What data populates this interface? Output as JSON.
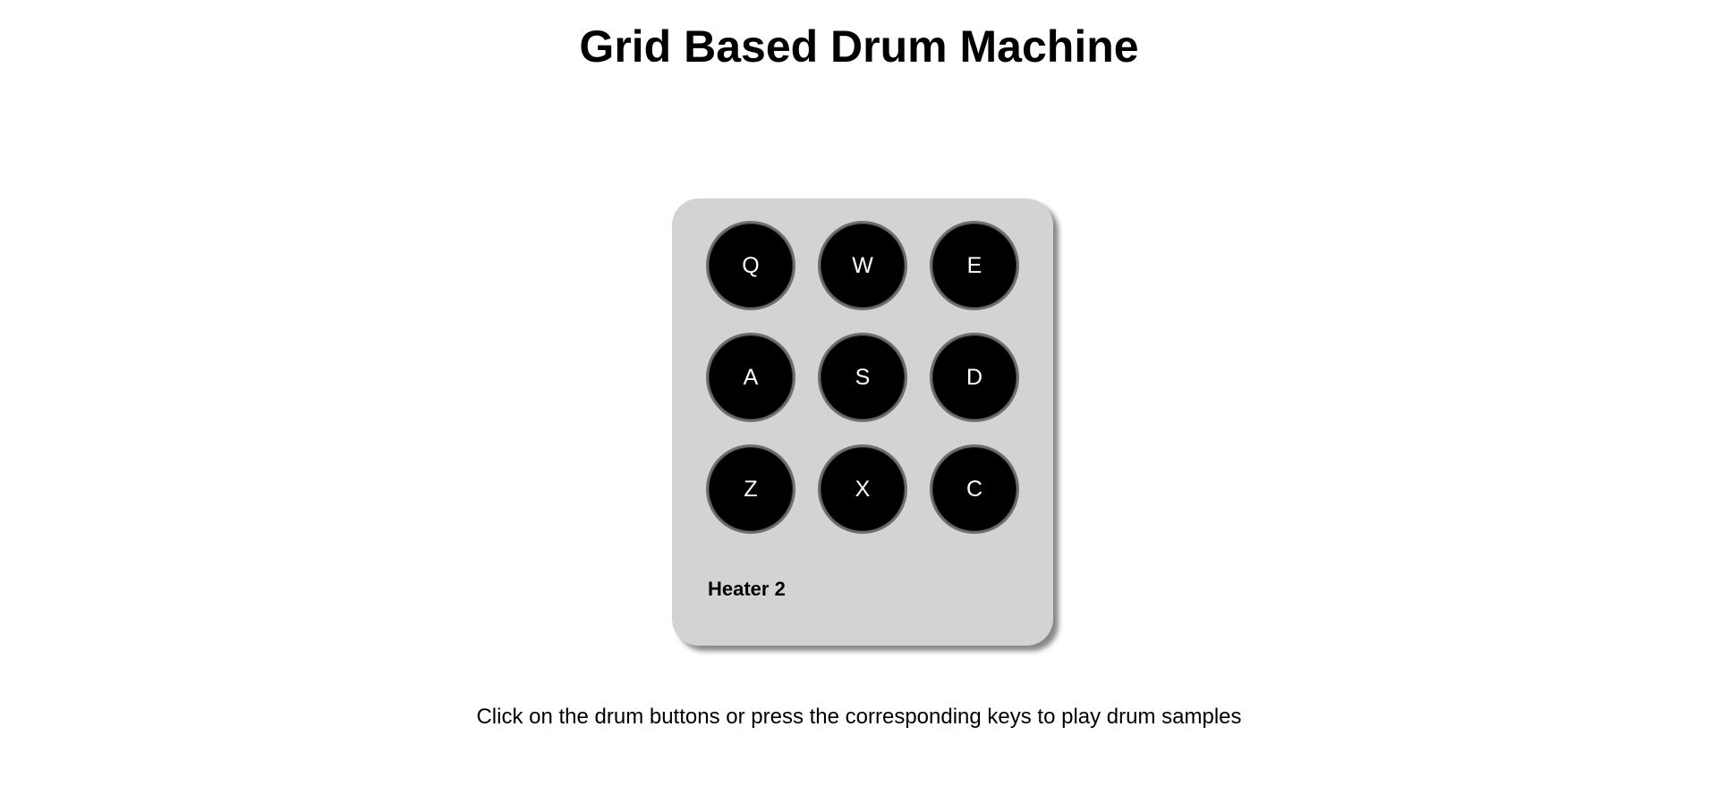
{
  "header": {
    "title": "Grid Based Drum Machine"
  },
  "drum_machine": {
    "pads": [
      {
        "key": "Q"
      },
      {
        "key": "W"
      },
      {
        "key": "E"
      },
      {
        "key": "A"
      },
      {
        "key": "S"
      },
      {
        "key": "D"
      },
      {
        "key": "Z"
      },
      {
        "key": "X"
      },
      {
        "key": "C"
      }
    ],
    "display_text": "Heater 2"
  },
  "instructions": "Click on the drum buttons or press the corresponding keys to play drum samples",
  "colors": {
    "machine_background": "#d3d3d3",
    "pad_fill": "#000000",
    "pad_border": "#6e6e6e",
    "pad_text": "#ffffff"
  }
}
